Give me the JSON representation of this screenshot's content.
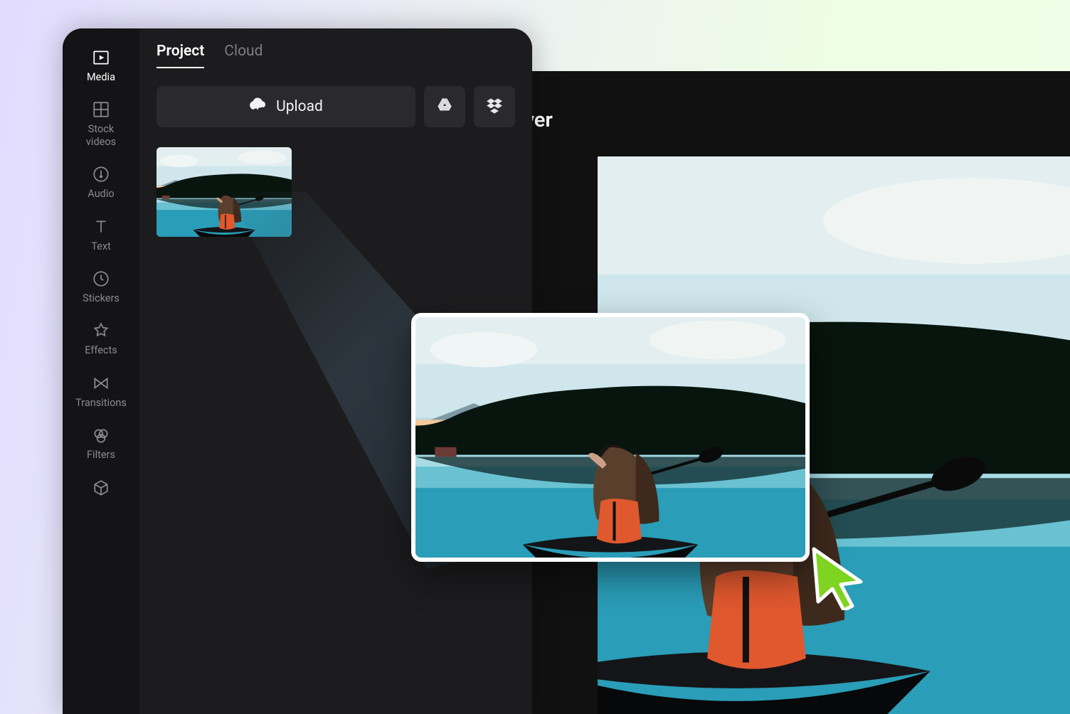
{
  "sidebar": {
    "items": [
      {
        "label": "Media",
        "icon": "media-icon",
        "active": true
      },
      {
        "label": "Stock\nvideos",
        "icon": "stock-icon",
        "active": false
      },
      {
        "label": "Audio",
        "icon": "audio-icon",
        "active": false
      },
      {
        "label": "Text",
        "icon": "text-icon",
        "active": false
      },
      {
        "label": "Stickers",
        "icon": "stickers-icon",
        "active": false
      },
      {
        "label": "Effects",
        "icon": "effects-icon",
        "active": false
      },
      {
        "label": "Transitions",
        "icon": "transitions-icon",
        "active": false
      },
      {
        "label": "Filters",
        "icon": "filters-icon",
        "active": false
      },
      {
        "label": "",
        "icon": "cube-icon",
        "active": false
      }
    ]
  },
  "mediaPanel": {
    "tabs": [
      {
        "label": "Project",
        "active": true
      },
      {
        "label": "Cloud",
        "active": false
      }
    ],
    "uploadLabel": "Upload",
    "cloudProviders": [
      {
        "name": "google-drive"
      },
      {
        "name": "dropbox"
      }
    ]
  },
  "player": {
    "title": "Player"
  }
}
